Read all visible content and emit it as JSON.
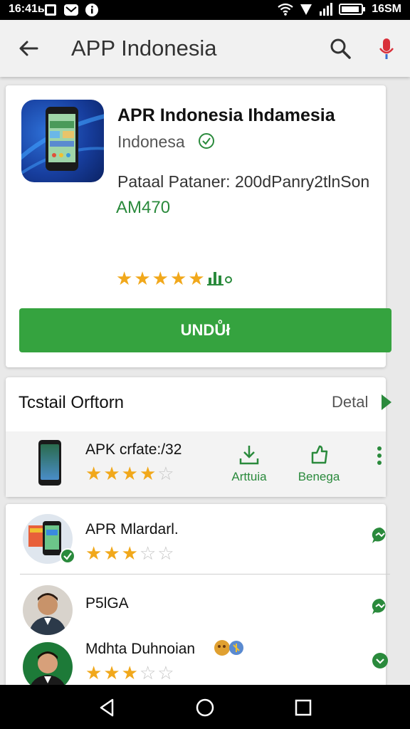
{
  "status_bar": {
    "time": "16:41ь",
    "battery_text": "16SM",
    "icons": [
      "notification-square-icon",
      "mail-icon",
      "info-icon",
      "wifi-icon",
      "signal-icon",
      "cellular-bars-icon",
      "battery-icon"
    ]
  },
  "appbar": {
    "title": "APP Indonesia",
    "icons": [
      "back-arrow-icon",
      "search-icon",
      "mic-icon"
    ]
  },
  "app": {
    "name": "APR Indonesia Ihdamesia",
    "developer": "Indonesa",
    "description": "Pataal Pataner: 200dPanry2tlnSon",
    "code": "AM470",
    "rating": 5,
    "install_label": "UNDŮł"
  },
  "section": {
    "title": "Tcstail Orftorn",
    "more_label": "Detal",
    "item": {
      "name": "APK crfate:/32",
      "rating": 4,
      "rating_max": 5,
      "actions": [
        {
          "label": "Arttuia",
          "icon": "download-icon"
        },
        {
          "label": "Benega",
          "icon": "share-icon"
        }
      ]
    }
  },
  "people": [
    {
      "name": "APR Mlardarl.",
      "rating": 3,
      "rating_max": 5
    },
    {
      "name": "P5lGA"
    },
    {
      "name": "Mdhta Duhnoian",
      "rating": 3,
      "rating_max": 5
    }
  ],
  "colors": {
    "accent_green": "#35a33f",
    "text_green": "#2a8a3c",
    "star_gold": "#f1a81b"
  }
}
